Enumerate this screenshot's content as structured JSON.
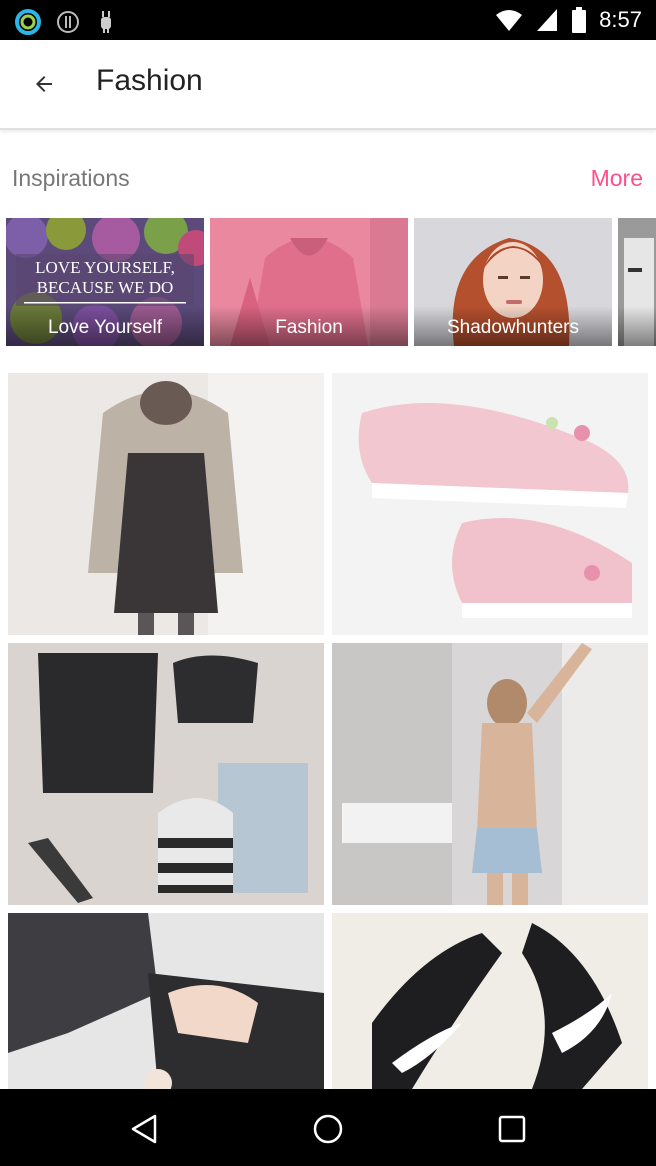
{
  "status_bar": {
    "time": "8:57",
    "left_icons": [
      "ring-app-icon",
      "download-status-icon",
      "android-debug-icon"
    ],
    "right_icons": [
      "wifi-icon",
      "cellular-signal-icon",
      "battery-icon"
    ]
  },
  "app_bar": {
    "back_icon": "arrow-left-icon",
    "title": "Fashion"
  },
  "inspirations": {
    "label": "Inspirations",
    "more_label": "More",
    "accent_color": "#ff4f8b",
    "items": [
      {
        "label": "Love Yourself",
        "image_text": "LOVE YOURSELF, BECAUSE WE DO"
      },
      {
        "label": "Fashion"
      },
      {
        "label": "Shadowhunters"
      },
      {
        "label": ""
      }
    ]
  },
  "feed": {
    "tiles": [
      {
        "subject": "outfit-black-dress-jacket"
      },
      {
        "subject": "pink-floral-sneakers"
      },
      {
        "subject": "leather-vest-flatlay"
      },
      {
        "subject": "denim-shorts-mirror"
      },
      {
        "subject": "black-ankle-boots"
      },
      {
        "subject": "black-white-sneakers"
      }
    ]
  },
  "nav_bar": {
    "back_icon": "triangle-back-icon",
    "home_icon": "circle-home-icon",
    "recents_icon": "square-recents-icon"
  }
}
